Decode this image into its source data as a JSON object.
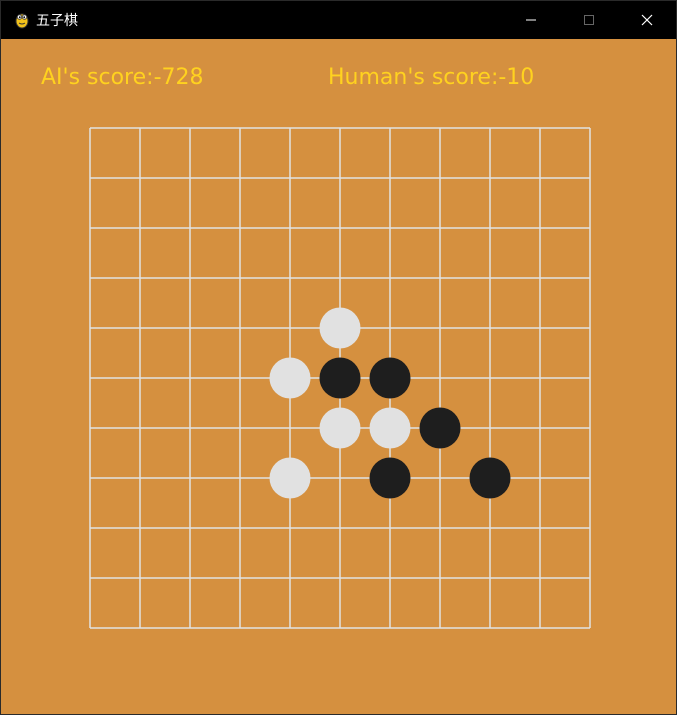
{
  "window": {
    "title": "五子棋",
    "app_icon": "pygame-snake-icon",
    "controls": [
      "minimize-icon",
      "maximize-icon",
      "close-icon"
    ]
  },
  "scores": {
    "ai": "AI's score:-728",
    "human": "Human's score:-10"
  },
  "colors": {
    "background": "#d5903f",
    "grid": "#e2e2e2",
    "score_text": "#ffd21f",
    "white_stone": "#e1e1e1",
    "black_stone": "#1e1e1e"
  },
  "board": {
    "cells": 10,
    "stones": [
      {
        "col": 5,
        "row": 4,
        "color": "white"
      },
      {
        "col": 4,
        "row": 5,
        "color": "white"
      },
      {
        "col": 5,
        "row": 5,
        "color": "black"
      },
      {
        "col": 6,
        "row": 5,
        "color": "black"
      },
      {
        "col": 5,
        "row": 6,
        "color": "white"
      },
      {
        "col": 6,
        "row": 6,
        "color": "white"
      },
      {
        "col": 7,
        "row": 6,
        "color": "black"
      },
      {
        "col": 4,
        "row": 7,
        "color": "white"
      },
      {
        "col": 6,
        "row": 7,
        "color": "black"
      },
      {
        "col": 8,
        "row": 7,
        "color": "black"
      }
    ]
  }
}
